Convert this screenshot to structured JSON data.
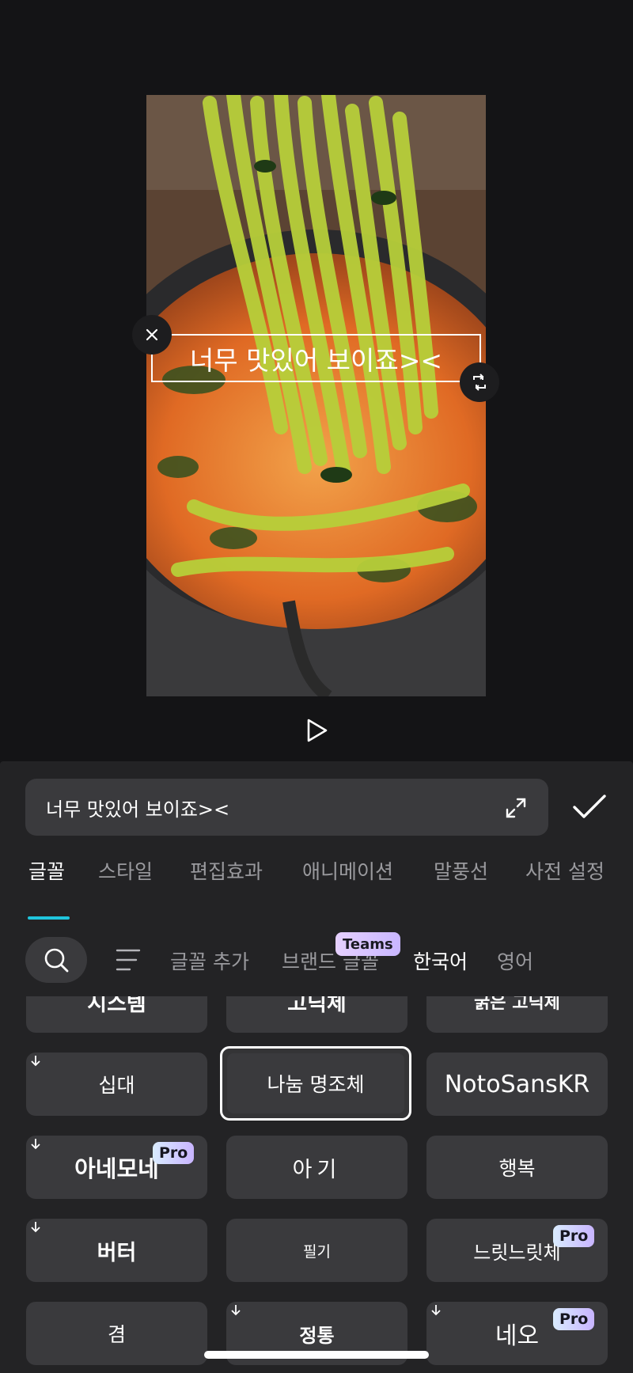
{
  "preview": {
    "caption": "너무 맛있어 보이죠><"
  },
  "editor": {
    "text_value": "너무 맛있어 보이죠><",
    "tabs": [
      "글꼴",
      "스타일",
      "편집효과",
      "애니메이션",
      "말풍선",
      "사전 설정"
    ],
    "active_tab": "글꼴",
    "filters": [
      "글꼴 추가",
      "브랜드 글꼴",
      "한국어",
      "영어"
    ],
    "active_filter": "한국어",
    "teams_badge": "Teams",
    "fonts": [
      {
        "name": "시스템",
        "downloadable": false,
        "pro": false,
        "selected": false
      },
      {
        "name": "고딕체",
        "downloadable": false,
        "pro": false,
        "selected": false
      },
      {
        "name": "굵은 고딕체",
        "downloadable": false,
        "pro": false,
        "selected": false
      },
      {
        "name": "십대",
        "downloadable": true,
        "pro": false,
        "selected": false
      },
      {
        "name": "나눔 명조체",
        "downloadable": false,
        "pro": false,
        "selected": true
      },
      {
        "name": "NotoSansKR",
        "downloadable": false,
        "pro": false,
        "selected": false
      },
      {
        "name": "아네모네",
        "downloadable": true,
        "pro": true,
        "selected": false
      },
      {
        "name": "아기",
        "downloadable": false,
        "pro": false,
        "selected": false
      },
      {
        "name": "행복",
        "downloadable": false,
        "pro": false,
        "selected": false
      },
      {
        "name": "버터",
        "downloadable": true,
        "pro": false,
        "selected": false
      },
      {
        "name": "필기",
        "downloadable": false,
        "pro": false,
        "selected": false
      },
      {
        "name": "느릿느릿체",
        "downloadable": false,
        "pro": true,
        "selected": false
      },
      {
        "name": "겸",
        "downloadable": false,
        "pro": false,
        "selected": false
      },
      {
        "name": "정통",
        "downloadable": true,
        "pro": false,
        "selected": false
      },
      {
        "name": "네오",
        "downloadable": true,
        "pro": true,
        "selected": false
      }
    ],
    "pro_label": "Pro"
  },
  "colors": {
    "accent": "#1fc5dd",
    "panel_bg": "#232325",
    "cell_bg": "#3a3a3d"
  }
}
